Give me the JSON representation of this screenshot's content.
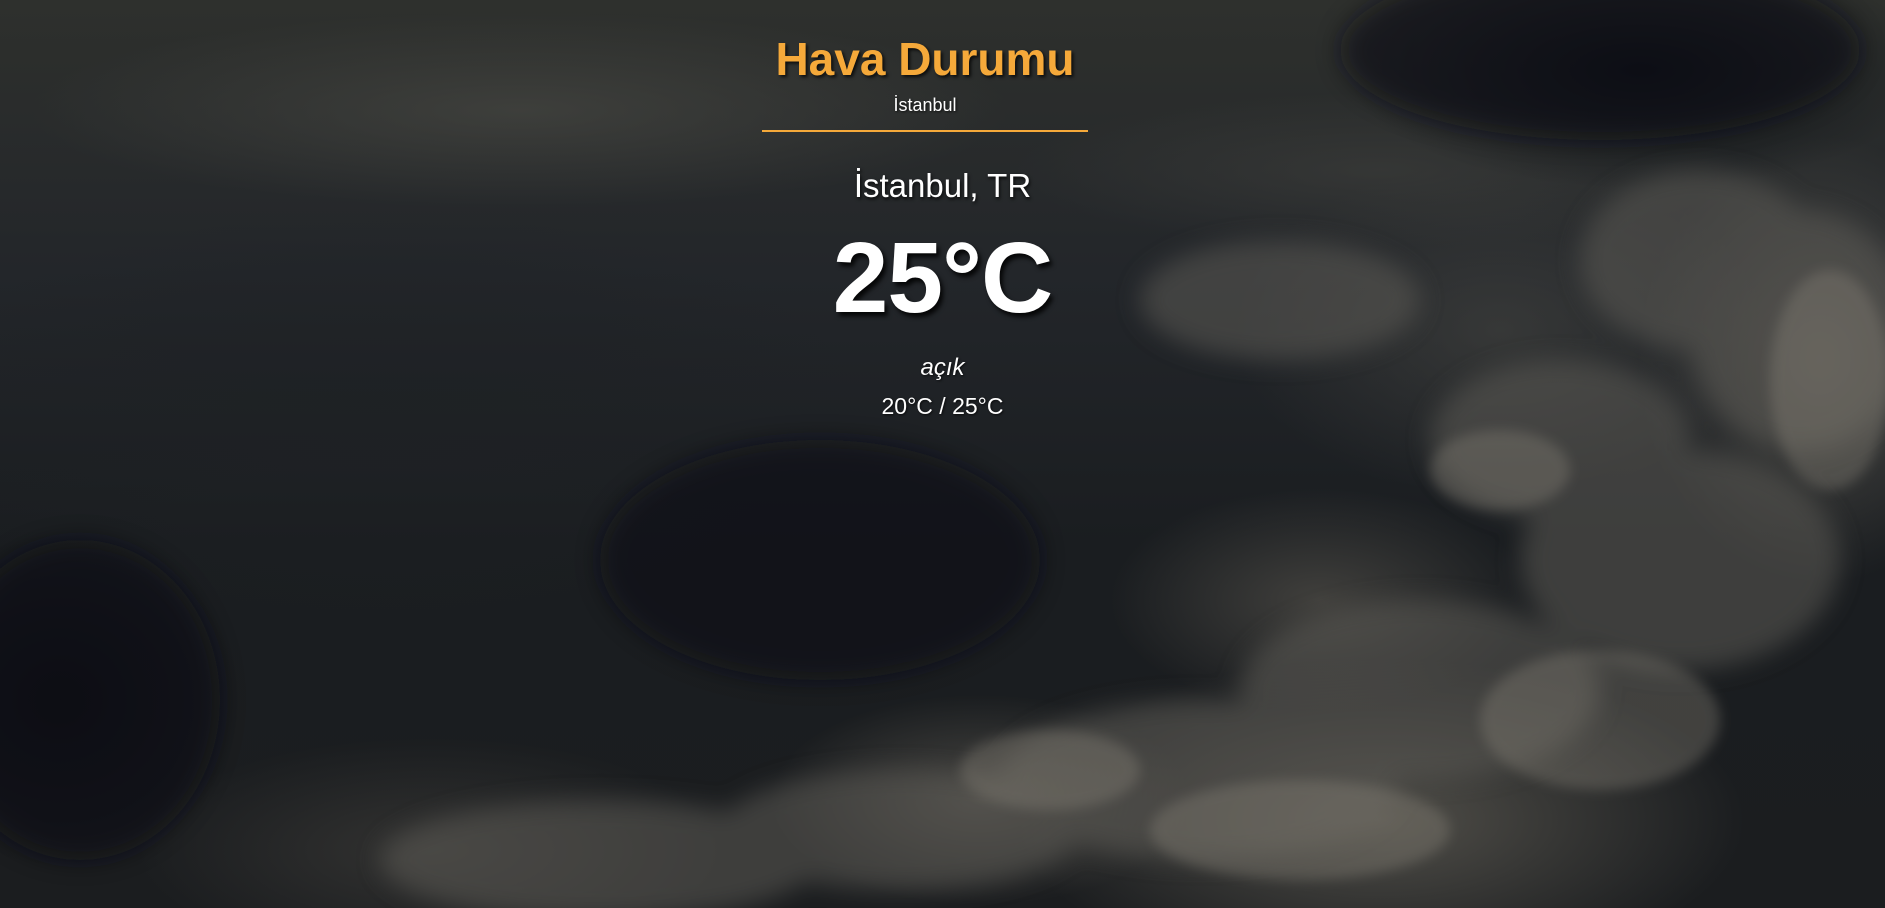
{
  "header": {
    "title": "Hava Durumu",
    "city": "İstanbul"
  },
  "weather": {
    "location": "İstanbul, TR",
    "temperature": "25°C",
    "description": "açık",
    "min_max": "20°C / 25°C"
  },
  "colors": {
    "accent": "#f5a93a",
    "text": "#ffffff",
    "background": "#1b1d1f"
  }
}
